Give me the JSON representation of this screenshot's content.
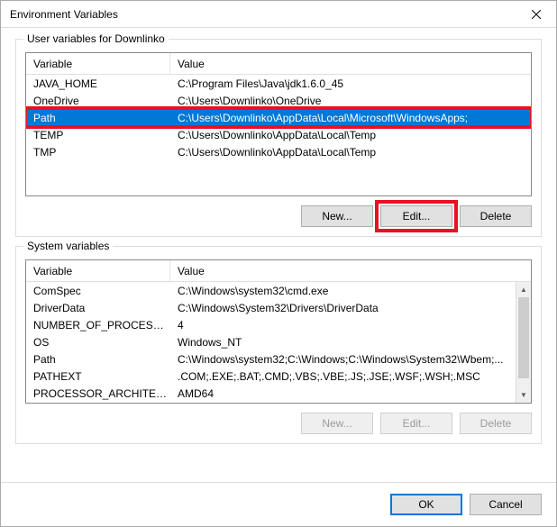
{
  "window": {
    "title": "Environment Variables"
  },
  "user_section": {
    "label": "User variables for Downlinko",
    "columns": {
      "var": "Variable",
      "val": "Value"
    },
    "rows": [
      {
        "var": "JAVA_HOME",
        "val": "C:\\Program Files\\Java\\jdk1.6.0_45"
      },
      {
        "var": "OneDrive",
        "val": "C:\\Users\\Downlinko\\OneDrive"
      },
      {
        "var": "Path",
        "val": "C:\\Users\\Downlinko\\AppData\\Local\\Microsoft\\WindowsApps;",
        "selected": true
      },
      {
        "var": "TEMP",
        "val": "C:\\Users\\Downlinko\\AppData\\Local\\Temp"
      },
      {
        "var": "TMP",
        "val": "C:\\Users\\Downlinko\\AppData\\Local\\Temp"
      }
    ],
    "buttons": {
      "new": "New...",
      "edit": "Edit...",
      "delete": "Delete"
    }
  },
  "system_section": {
    "label": "System variables",
    "columns": {
      "var": "Variable",
      "val": "Value"
    },
    "rows": [
      {
        "var": "ComSpec",
        "val": "C:\\Windows\\system32\\cmd.exe"
      },
      {
        "var": "DriverData",
        "val": "C:\\Windows\\System32\\Drivers\\DriverData"
      },
      {
        "var": "NUMBER_OF_PROCESSORS",
        "val": "4"
      },
      {
        "var": "OS",
        "val": "Windows_NT"
      },
      {
        "var": "Path",
        "val": "C:\\Windows\\system32;C:\\Windows;C:\\Windows\\System32\\Wbem;..."
      },
      {
        "var": "PATHEXT",
        "val": ".COM;.EXE;.BAT;.CMD;.VBS;.VBE;.JS;.JSE;.WSF;.WSH;.MSC"
      },
      {
        "var": "PROCESSOR_ARCHITECTURE",
        "val": "AMD64"
      }
    ],
    "buttons": {
      "new": "New...",
      "edit": "Edit...",
      "delete": "Delete"
    }
  },
  "footer": {
    "ok": "OK",
    "cancel": "Cancel"
  }
}
